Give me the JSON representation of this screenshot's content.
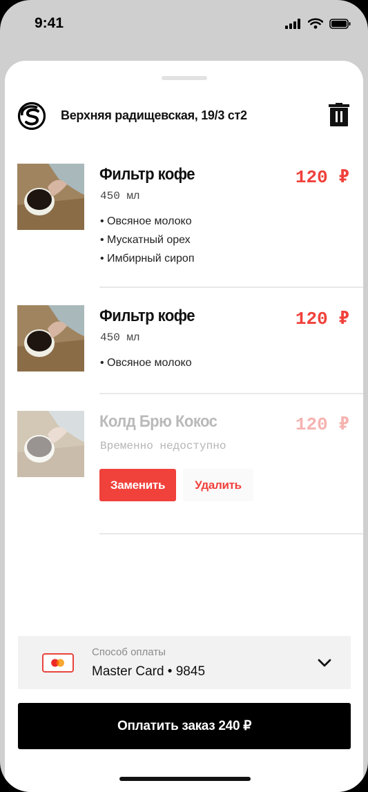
{
  "status_bar": {
    "time": "9:41"
  },
  "header": {
    "logo_icon": "coffee-logo-icon",
    "address": "Верхняя радищевская, 19/3 ст2",
    "trash_icon": "trash-icon"
  },
  "items": [
    {
      "name": "Фильтр кофе",
      "volume": "450 мл",
      "price": "120 ₽",
      "addons": [
        "Овсяное молоко",
        "Мускатный орех",
        "Имбирный сироп"
      ]
    },
    {
      "name": "Фильтр кофе",
      "volume": "450 мл",
      "price": "120 ₽",
      "addons": [
        "Овсяное молоко"
      ]
    },
    {
      "name": "Колд Брю Кокос",
      "note": "Временно недоступно",
      "price": "120 ₽",
      "replace_label": "Заменить",
      "delete_label": "Удалить"
    }
  ],
  "payment": {
    "label": "Способ оплаты",
    "method": "Master Card • 9845",
    "card_icon": "mastercard-icon"
  },
  "pay_button": {
    "label": "Оплатить заказ 240 ₽"
  },
  "colors": {
    "accent": "#f0413b",
    "dark": "#000000",
    "panel": "#f2f2f2"
  }
}
